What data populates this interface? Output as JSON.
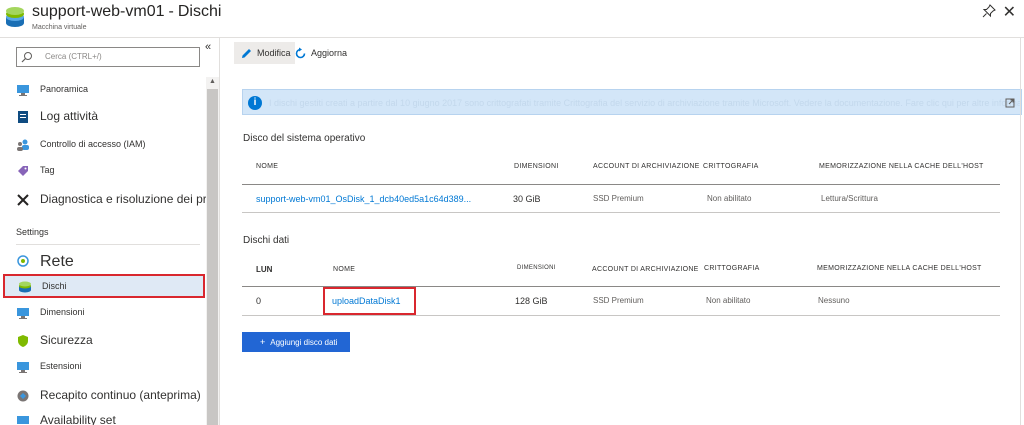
{
  "header": {
    "resource_name": "support-web-vm01",
    "separator": "-",
    "page_name": "Dischi",
    "resource_type": "Macchina virtuale",
    "pin_icon": "pin-icon",
    "close_icon": "close-icon"
  },
  "sidebar": {
    "search_placeholder": "Cerca (CTRL+/)",
    "collapse_glyph": "«",
    "items_top": [
      {
        "label": "Panoramica",
        "icon": "monitor-icon"
      },
      {
        "label": "Log attività",
        "icon": "log-icon"
      },
      {
        "label": "Controllo di accesso (IAM)",
        "icon": "people-icon"
      },
      {
        "label": "Tag",
        "icon": "tag-icon"
      },
      {
        "label": "Diagnostica e risoluzione dei problemi",
        "icon": "wrench-icon"
      }
    ],
    "settings_header": "Settings",
    "items_settings": [
      {
        "label": "Rete",
        "icon": "network-icon"
      },
      {
        "label": "Dischi",
        "icon": "disk-icon"
      },
      {
        "label": "Dimensioni",
        "icon": "monitor-icon"
      },
      {
        "label": "Sicurezza",
        "icon": "shield-icon"
      },
      {
        "label": "Estensioni",
        "icon": "extensions-icon"
      },
      {
        "label": "Recapito continuo (anteprima)",
        "icon": "delivery-icon"
      },
      {
        "label": "Availability set",
        "icon": "availability-icon"
      }
    ]
  },
  "toolbar": {
    "edit_label": "Modifica",
    "refresh_label": "Aggiorna"
  },
  "info_bar": {
    "text": "I dischi gestiti creati a partire dal 10 giugno 2017 sono crittografati tramite Crittografia del servizio di archiviazione tramite Microsoft. Vedere la documentazione. Fare clic qui per altre informazioni."
  },
  "os_disk": {
    "section_title": "Disco del sistema operativo",
    "headers": [
      "NOME",
      "DIMENSIONI",
      "ACCOUNT DI ARCHIVIAZIONE",
      "CRITTOGRAFIA",
      "MEMORIZZAZIONE NELLA CACHE DELL'HOST"
    ],
    "row": {
      "name": "support-web-vm01_OsDisk_1_dcb40ed5a1c64d389...",
      "size": "30 GiB",
      "storage": "SSD Premium",
      "encryption": "Non abilitato",
      "cache": "Lettura/Scrittura"
    }
  },
  "data_disks": {
    "section_title": "Dischi dati",
    "headers": [
      "LUN",
      "NOME",
      "DIMENSIONI",
      "ACCOUNT DI ARCHIVIAZIONE",
      "CRITTOGRAFIA",
      "MEMORIZZAZIONE NELLA CACHE DELL'HOST"
    ],
    "row": {
      "lun": "0",
      "name": "uploadDataDisk1",
      "size": "128 GiB",
      "storage": "SSD Premium",
      "encryption": "Non abilitato",
      "cache": "Nessuno"
    },
    "add_button_label": "Aggiungi disco dati"
  },
  "colors": {
    "accent": "#0078d4",
    "selected_bg": "#dfe9f5",
    "highlight_border": "#d9272e",
    "primary_button": "#2266d4"
  }
}
